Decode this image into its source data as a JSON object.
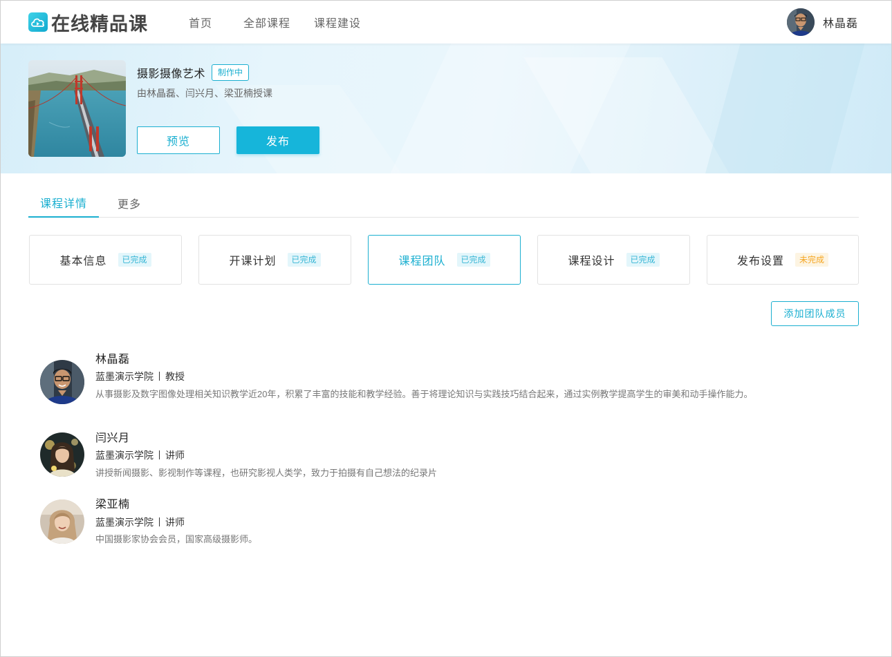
{
  "header": {
    "logo_text": "在线精品课",
    "nav": [
      {
        "label": "首页"
      },
      {
        "label": "全部课程"
      },
      {
        "label": "课程建设"
      }
    ],
    "user": {
      "name": "林晶磊"
    }
  },
  "course": {
    "title": "摄影摄像艺术",
    "status": "制作中",
    "teachers": "由林晶磊、闫兴月、梁亚楠授课",
    "preview_label": "预览",
    "publish_label": "发布"
  },
  "tabs": [
    {
      "label": "课程详情",
      "active": true
    },
    {
      "label": "更多",
      "active": false
    }
  ],
  "steps": [
    {
      "label": "基本信息",
      "status": "已完成"
    },
    {
      "label": "开课计划",
      "status": "已完成"
    },
    {
      "label": "课程团队",
      "status": "已完成",
      "active": true
    },
    {
      "label": "课程设计",
      "status": "已完成"
    },
    {
      "label": "发布设置",
      "status": "未完成"
    }
  ],
  "add_member_label": "添加团队成员",
  "members": [
    {
      "name": "林晶磊",
      "org": "蓝墨演示学院",
      "title": "教授",
      "bio": "从事摄影及数字图像处理相关知识教学近20年，积累了丰富的技能和教学经验。善于将理论知识与实践技巧结合起来，通过实例教学提高学生的审美和动手操作能力。"
    },
    {
      "name": "闫兴月",
      "org": "蓝墨演示学院",
      "title": "讲师",
      "bio": "讲授新闻摄影、影视制作等课程，也研究影视人类学，致力于拍摄有自己想法的纪录片"
    },
    {
      "name": "梁亚楠",
      "org": "蓝墨演示学院",
      "title": "讲师",
      "bio": "中国摄影家协会会员，国家高级摄影师。"
    }
  ],
  "colors": {
    "accent": "#1aafd0",
    "done_badge": "#38b6d5",
    "todo_badge": "#f5a623"
  }
}
